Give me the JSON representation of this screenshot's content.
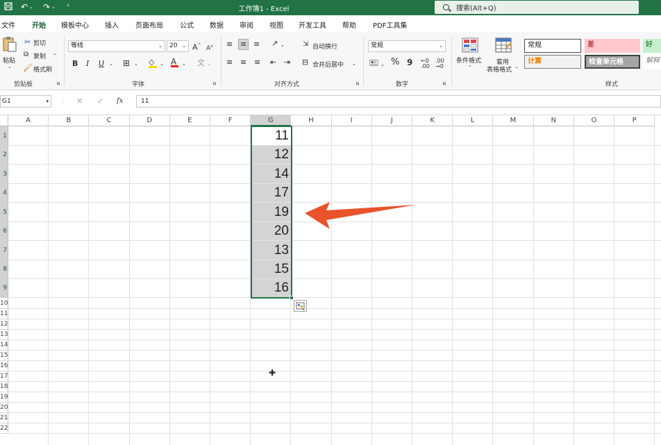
{
  "titlebar": {
    "title": "工作簿1 - Excel",
    "search_placeholder": "搜索(Alt+Q)",
    "bg_color": "#217346"
  },
  "menu": {
    "tabs": [
      "文件",
      "开始",
      "模板中心",
      "插入",
      "页面布局",
      "公式",
      "数据",
      "审阅",
      "视图",
      "开发工具",
      "帮助",
      "PDF工具集"
    ],
    "active": "开始"
  },
  "ribbon": {
    "clipboard": {
      "paste": "粘贴",
      "cut": "剪切",
      "copy": "复制",
      "format_painter": "格式刷",
      "label": "剪贴板"
    },
    "font": {
      "name": "等线",
      "size": "20",
      "bold": "B",
      "italic": "I",
      "underline": "U",
      "grow": "A",
      "shrink": "A",
      "label": "字体"
    },
    "alignment": {
      "wrap": "自动换行",
      "merge": "合并后居中",
      "label": "对齐方式"
    },
    "number": {
      "format": "常规",
      "percent": "%",
      "comma": "9",
      "label": "数字"
    },
    "styles": {
      "conditional": "条件格式",
      "table_line1": "套用",
      "table_line2": "表格格式",
      "normal": "常规",
      "bad": "差",
      "good": "好",
      "calc": "计算",
      "check": "检查单元格",
      "explain": "解释",
      "label": "样式"
    }
  },
  "formula_bar": {
    "name_box": "G1",
    "fx": "fx",
    "value": "11"
  },
  "sheet": {
    "columns": [
      "A",
      "B",
      "C",
      "D",
      "E",
      "F",
      "G",
      "H",
      "I",
      "J",
      "K",
      "L",
      "M",
      "N",
      "O",
      "P"
    ],
    "rows": [
      "1",
      "2",
      "3",
      "4",
      "5",
      "6",
      "7",
      "8",
      "9",
      "10",
      "11",
      "12",
      "13",
      "14",
      "15",
      "16",
      "17",
      "18",
      "19",
      "20",
      "21",
      "22"
    ],
    "selected_column": "G",
    "g_values": [
      "11",
      "12",
      "14",
      "17",
      "19",
      "20",
      "13",
      "15",
      "16"
    ],
    "selection_color": "#217346",
    "arrow_color": "#e8532b"
  }
}
